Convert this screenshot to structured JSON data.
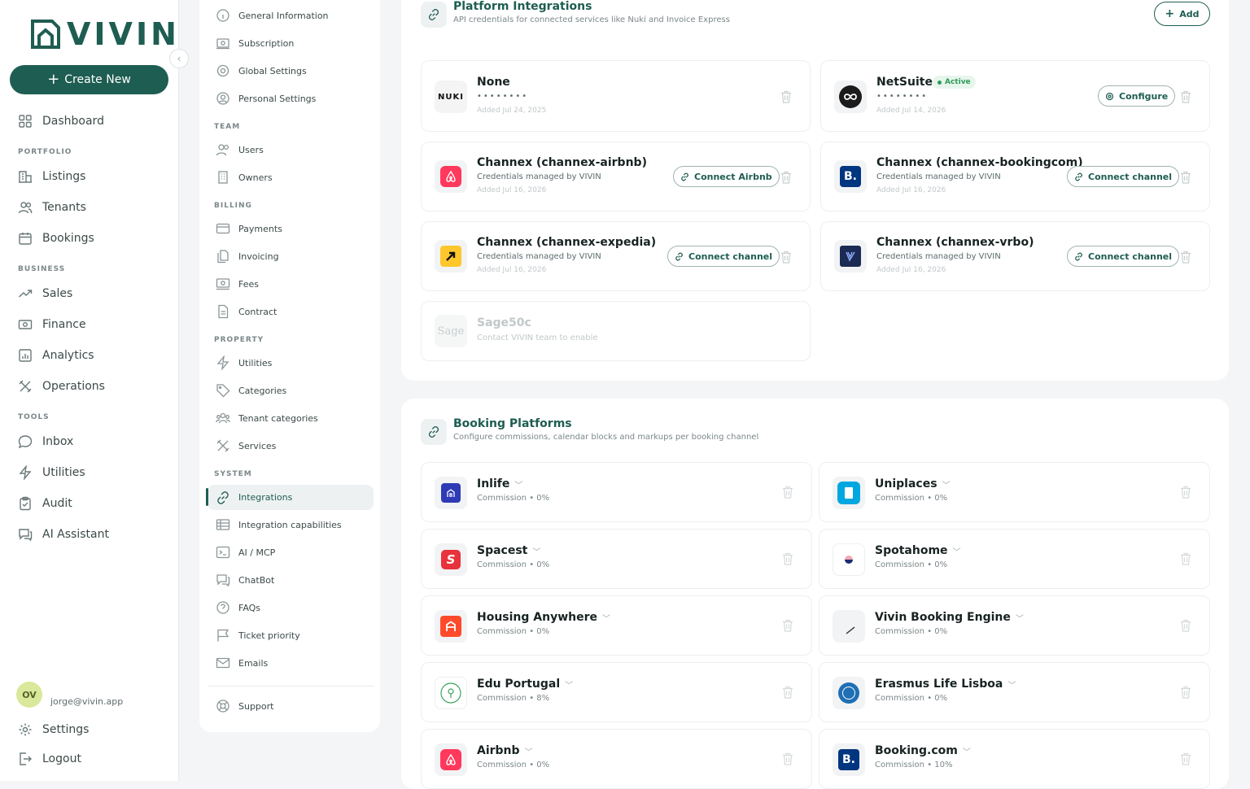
{
  "brand": {
    "name": "VIVIN",
    "accent": "#1e5d52"
  },
  "sidebar": {
    "create_label": "Create New",
    "items": [
      {
        "label": "Dashboard",
        "icon": "grid-icon"
      },
      {
        "label": "Listings",
        "icon": "building-icon"
      },
      {
        "label": "Tenants",
        "icon": "users-icon"
      },
      {
        "label": "Bookings",
        "icon": "calendar-icon"
      },
      {
        "label": "Sales",
        "icon": "trend-icon"
      },
      {
        "label": "Finance",
        "icon": "money-icon"
      },
      {
        "label": "Analytics",
        "icon": "chart-icon"
      },
      {
        "label": "Operations",
        "icon": "tools-icon"
      },
      {
        "label": "Inbox",
        "icon": "chat-icon"
      },
      {
        "label": "Utilities",
        "icon": "bolt-icon"
      },
      {
        "label": "Audit",
        "icon": "clipboard-icon"
      },
      {
        "label": "AI Assistant",
        "icon": "ai-chat-icon"
      }
    ],
    "sections": {
      "portfolio": "PORTFOLIO",
      "business": "BUSINESS",
      "tools": "TOOLS"
    },
    "user": {
      "initials": "OV",
      "email": "jorge@vivin.app"
    },
    "settings_label": "Settings",
    "logout_label": "Logout"
  },
  "settings_nav": {
    "general": [
      "General Information",
      "Subscription",
      "Global Settings",
      "Personal Settings"
    ],
    "team_title": "TEAM",
    "team": [
      "Users",
      "Owners"
    ],
    "billing_title": "BILLING",
    "billing": [
      "Payments",
      "Invoicing",
      "Fees",
      "Contract"
    ],
    "property_title": "PROPERTY",
    "property": [
      "Utilities",
      "Categories",
      "Tenant categories",
      "Services"
    ],
    "system_title": "SYSTEM",
    "system": [
      "Integrations",
      "Integration capabilities",
      "AI / MCP",
      "ChatBot",
      "FAQs",
      "Ticket priority",
      "Emails"
    ],
    "support": "Support"
  },
  "platform_integrations": {
    "title": "Platform Integrations",
    "subtitle": "API credentials for connected services like Nuki and Invoice Express",
    "add_label": "Add",
    "items": [
      {
        "name": "None",
        "masked": "••••••••",
        "date": "Added Jul 24, 2025",
        "logo": "NUKI"
      },
      {
        "name": "NetSuite",
        "badge": "Active",
        "masked": "••••••••",
        "date": "Added Jul 14, 2026",
        "action": "Configure"
      },
      {
        "name": "Channex (channex-airbnb)",
        "sub": "Credentials managed by VIVIN",
        "date": "Added Jul 16, 2026",
        "action": "Connect Airbnb"
      },
      {
        "name": "Channex (channex-bookingcom)",
        "sub": "Credentials managed by VIVIN",
        "date": "Added Jul 16, 2026",
        "action": "Connect channel",
        "logo": "B."
      },
      {
        "name": "Channex (channex-expedia)",
        "sub": "Credentials managed by VIVIN",
        "date": "Added Jul 16, 2026",
        "action": "Connect channel"
      },
      {
        "name": "Channex (channex-vrbo)",
        "sub": "Credentials managed by VIVIN",
        "date": "Added Jul 16, 2026",
        "action": "Connect channel"
      },
      {
        "name": "Sage50c",
        "sub": "Contact VIVIN team to enable",
        "logo": "Sage"
      }
    ]
  },
  "booking_platforms": {
    "title": "Booking Platforms",
    "subtitle": "Configure commissions, calendar blocks and markups per booking channel",
    "items": [
      {
        "name": "Inlife",
        "commission": "Commission • 0%"
      },
      {
        "name": "Uniplaces",
        "commission": "Commission • 0%"
      },
      {
        "name": "Spacest",
        "commission": "Commission • 0%"
      },
      {
        "name": "Spotahome",
        "commission": "Commission • 0%"
      },
      {
        "name": "Housing Anywhere",
        "commission": "Commission • 0%"
      },
      {
        "name": "Vivin Booking Engine",
        "commission": "Commission • 0%"
      },
      {
        "name": "Edu Portugal",
        "commission": "Commission • 8%"
      },
      {
        "name": "Erasmus Life Lisboa",
        "commission": "Commission • 0%"
      },
      {
        "name": "Airbnb",
        "commission": "Commission • 0%"
      },
      {
        "name": "Booking.com",
        "commission": "Commission • 10%",
        "logo": "B."
      }
    ]
  }
}
